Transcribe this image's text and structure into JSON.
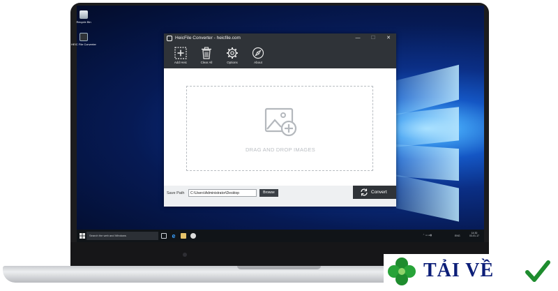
{
  "desktop": {
    "icons": [
      {
        "label": "Recycle Bin"
      },
      {
        "label": "HEIC File Converter"
      }
    ]
  },
  "taskbar": {
    "search_placeholder": "Search the web and Windows",
    "tray_language": "ENG",
    "time": "14:30",
    "date": "03-01-17"
  },
  "app": {
    "title": "HeicFile Converter - heicfile.com",
    "window_controls": {
      "minimize": "—",
      "maximize": "☐",
      "close": "✕"
    },
    "toolbar": [
      {
        "label": "Add Heic",
        "icon": "add-file-icon"
      },
      {
        "label": "Clear All",
        "icon": "trash-icon"
      },
      {
        "label": "Options",
        "icon": "gear-icon"
      },
      {
        "label": "About",
        "icon": "compass-icon"
      }
    ],
    "dropzone_text": "DRAG AND DROP IMAGES",
    "save_path_label": "Save Path",
    "save_path_value": "C:\\Users\\Administrator\\Desktop",
    "browse_label": "Browse",
    "convert_label": "Convert"
  },
  "watermark": {
    "text": "TẢI VỀ",
    "color": "#0c1e78",
    "accent": "#1e8c2e"
  }
}
